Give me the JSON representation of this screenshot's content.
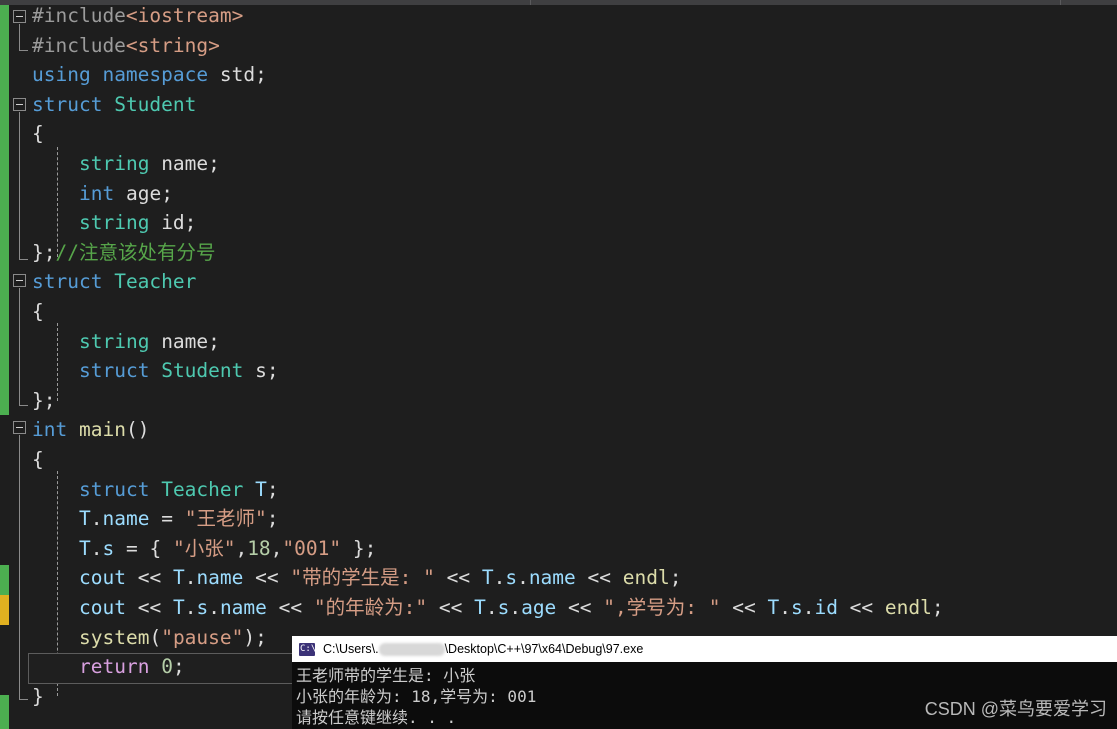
{
  "app": {
    "name": "visual-studio-code-editor",
    "theme": "dark"
  },
  "colors": {
    "editor_background": "#1e1e1e",
    "keyword": "#569cd6",
    "type": "#4ec9b0",
    "string": "#d69d85",
    "number": "#b5cea8",
    "comment": "#57a64a",
    "variable": "#9cdcfe",
    "function": "#dcdcaa",
    "control": "#d8a0df",
    "plain_text": "#dcdcdc",
    "changebar_saved": "#4caf50",
    "changebar_unsaved": "#e0b020",
    "console_background": "#0c0c0c",
    "console_titlebar": "#ffffff"
  },
  "editor": {
    "lines": [
      {
        "n": 1,
        "indent": 0,
        "text": "#include<iostream>"
      },
      {
        "n": 2,
        "indent": 0,
        "text": "#include<string>"
      },
      {
        "n": 3,
        "indent": 0,
        "text": "using namespace std;"
      },
      {
        "n": 4,
        "indent": 0,
        "text": "struct Student"
      },
      {
        "n": 5,
        "indent": 0,
        "text": "{"
      },
      {
        "n": 6,
        "indent": 1,
        "text": "string name;"
      },
      {
        "n": 7,
        "indent": 1,
        "text": "int age;"
      },
      {
        "n": 8,
        "indent": 1,
        "text": "string id;"
      },
      {
        "n": 9,
        "indent": 0,
        "text": "};//注意该处有分号"
      },
      {
        "n": 10,
        "indent": 0,
        "text": "struct Teacher"
      },
      {
        "n": 11,
        "indent": 0,
        "text": "{"
      },
      {
        "n": 12,
        "indent": 1,
        "text": "string name;"
      },
      {
        "n": 13,
        "indent": 1,
        "text": "struct Student s;"
      },
      {
        "n": 14,
        "indent": 0,
        "text": "};"
      },
      {
        "n": 15,
        "indent": 0,
        "text": "int main()"
      },
      {
        "n": 16,
        "indent": 0,
        "text": "{"
      },
      {
        "n": 17,
        "indent": 1,
        "text": "struct Teacher T;"
      },
      {
        "n": 18,
        "indent": 1,
        "text": "T.name = \"王老师\";"
      },
      {
        "n": 19,
        "indent": 1,
        "text": "T.s = { \"小张\",18,\"001\" };"
      },
      {
        "n": 20,
        "indent": 1,
        "text": "cout << T.name << \"带的学生是: \" << T.s.name << endl;"
      },
      {
        "n": 21,
        "indent": 1,
        "text": "cout << T.s.name << \"的年龄为:\" << T.s.age << \",学号为: \" << T.s.id << endl;"
      },
      {
        "n": 22,
        "indent": 1,
        "text": "system(\"pause\");"
      },
      {
        "n": 23,
        "indent": 1,
        "text": "return 0;"
      },
      {
        "n": 24,
        "indent": 0,
        "text": "}"
      }
    ],
    "current_line_number": 23,
    "collapse_markers": [
      1,
      4,
      10,
      15
    ],
    "changebar_saved_ranges": "lines 1-14 and 24",
    "changebar_unsaved_ranges": "lines 20-21"
  },
  "code_tokens": {
    "l1": [
      [
        "pre",
        "#include"
      ],
      [
        "inc",
        "<iostream>"
      ]
    ],
    "l2": [
      [
        "pre",
        "#include"
      ],
      [
        "inc",
        "<string>"
      ]
    ],
    "l3": [
      [
        "kw",
        "using"
      ],
      [
        "plain",
        " "
      ],
      [
        "kw",
        "namespace"
      ],
      [
        "plain",
        " std;"
      ]
    ],
    "l4": [
      [
        "kw",
        "struct"
      ],
      [
        "plain",
        " "
      ],
      [
        "type",
        "Student"
      ]
    ],
    "l5": [
      [
        "brace",
        "{"
      ]
    ],
    "l6": [
      [
        "type",
        "string"
      ],
      [
        "plain",
        " name;"
      ]
    ],
    "l7": [
      [
        "kw",
        "int"
      ],
      [
        "plain",
        " age;"
      ]
    ],
    "l8": [
      [
        "type",
        "string"
      ],
      [
        "plain",
        " id;"
      ]
    ],
    "l9": [
      [
        "brace",
        "};"
      ],
      [
        "cmt",
        "//注意该处有分号"
      ]
    ],
    "l10": [
      [
        "kw",
        "struct"
      ],
      [
        "plain",
        " "
      ],
      [
        "type",
        "Teacher"
      ]
    ],
    "l11": [
      [
        "brace",
        "{"
      ]
    ],
    "l12": [
      [
        "type",
        "string"
      ],
      [
        "plain",
        " name;"
      ]
    ],
    "l13": [
      [
        "kw",
        "struct"
      ],
      [
        "plain",
        " "
      ],
      [
        "type",
        "Student"
      ],
      [
        "plain",
        " s;"
      ]
    ],
    "l14": [
      [
        "brace",
        "};"
      ]
    ],
    "l15": [
      [
        "kw",
        "int"
      ],
      [
        "plain",
        " "
      ],
      [
        "fn",
        "main"
      ],
      [
        "plain",
        "()"
      ]
    ],
    "l16": [
      [
        "brace",
        "{"
      ]
    ],
    "l17": [
      [
        "kw",
        "struct"
      ],
      [
        "plain",
        " "
      ],
      [
        "type",
        "Teacher"
      ],
      [
        "plain",
        " "
      ],
      [
        "var",
        "T"
      ],
      [
        "plain",
        ";"
      ]
    ],
    "l18": [
      [
        "var",
        "T"
      ],
      [
        "plain",
        "."
      ],
      [
        "var",
        "name"
      ],
      [
        "plain",
        " = "
      ],
      [
        "str",
        "\"王老师\""
      ],
      [
        "plain",
        ";"
      ]
    ],
    "l19": [
      [
        "var",
        "T"
      ],
      [
        "plain",
        "."
      ],
      [
        "var",
        "s"
      ],
      [
        "plain",
        " = { "
      ],
      [
        "str",
        "\"小张\""
      ],
      [
        "plain",
        ","
      ],
      [
        "num",
        "18"
      ],
      [
        "plain",
        ","
      ],
      [
        "str",
        "\"001\""
      ],
      [
        "plain",
        " };"
      ]
    ],
    "l20": [
      [
        "var",
        "cout"
      ],
      [
        "plain",
        " << "
      ],
      [
        "var",
        "T"
      ],
      [
        "plain",
        "."
      ],
      [
        "var",
        "name"
      ],
      [
        "plain",
        " << "
      ],
      [
        "str",
        "\"带的学生是: \""
      ],
      [
        "plain",
        " << "
      ],
      [
        "var",
        "T"
      ],
      [
        "plain",
        "."
      ],
      [
        "var",
        "s"
      ],
      [
        "plain",
        "."
      ],
      [
        "var",
        "name"
      ],
      [
        "plain",
        " << "
      ],
      [
        "fn",
        "endl"
      ],
      [
        "plain",
        ";"
      ]
    ],
    "l21": [
      [
        "var",
        "cout"
      ],
      [
        "plain",
        " << "
      ],
      [
        "var",
        "T"
      ],
      [
        "plain",
        "."
      ],
      [
        "var",
        "s"
      ],
      [
        "plain",
        "."
      ],
      [
        "var",
        "name"
      ],
      [
        "plain",
        " << "
      ],
      [
        "str",
        "\"的年龄为:\""
      ],
      [
        "plain",
        " << "
      ],
      [
        "var",
        "T"
      ],
      [
        "plain",
        "."
      ],
      [
        "var",
        "s"
      ],
      [
        "plain",
        "."
      ],
      [
        "var",
        "age"
      ],
      [
        "plain",
        " << "
      ],
      [
        "str",
        "\",学号为: \""
      ],
      [
        "plain",
        " << "
      ],
      [
        "var",
        "T"
      ],
      [
        "plain",
        "."
      ],
      [
        "var",
        "s"
      ],
      [
        "plain",
        "."
      ],
      [
        "var",
        "id"
      ],
      [
        "plain",
        " << "
      ],
      [
        "fn",
        "endl"
      ],
      [
        "plain",
        ";"
      ]
    ],
    "l22": [
      [
        "fn",
        "system"
      ],
      [
        "plain",
        "("
      ],
      [
        "str",
        "\"pause\""
      ],
      [
        "plain",
        ");"
      ]
    ],
    "l23": [
      [
        "ctrl",
        "return"
      ],
      [
        "plain",
        " "
      ],
      [
        "num",
        "0"
      ],
      [
        "plain",
        ";"
      ]
    ],
    "l24": [
      [
        "brace",
        "}"
      ]
    ]
  },
  "console": {
    "icon": "console-app-icon",
    "icon_glyph": "C:\\",
    "title_prefix": "C:\\Users\\.",
    "title_suffix": "\\Desktop\\C++\\97\\x64\\Debug\\97.exe",
    "title_redacted": true,
    "output": [
      "王老师带的学生是: 小张",
      "小张的年龄为: 18,学号为: 001",
      "请按任意键继续. . ."
    ]
  },
  "watermark": {
    "text": "CSDN @菜鸟要爱学习"
  }
}
